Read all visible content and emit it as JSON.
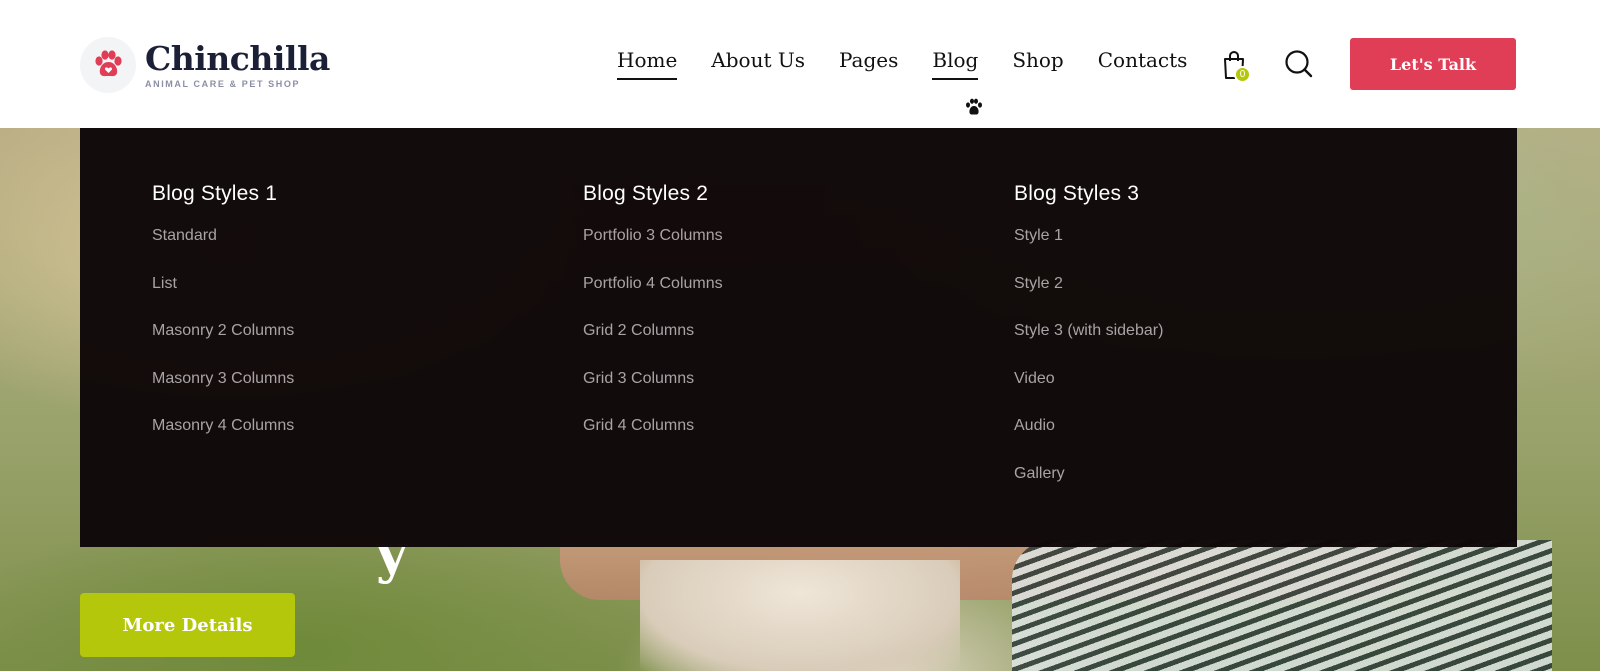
{
  "brand": {
    "name": "Chinchilla",
    "tagline": "ANIMAL CARE & PET SHOP",
    "accent": "#e03e56",
    "secondary": "#b5c70a"
  },
  "nav": {
    "items": [
      {
        "label": "Home",
        "active": true
      },
      {
        "label": "About Us",
        "active": false
      },
      {
        "label": "Pages",
        "active": false
      },
      {
        "label": "Blog",
        "active": true
      },
      {
        "label": "Shop",
        "active": false
      },
      {
        "label": "Contacts",
        "active": false
      }
    ]
  },
  "cart": {
    "count": "0"
  },
  "cta": {
    "label": "Let's Talk"
  },
  "mega_menu": {
    "columns": [
      {
        "title": "Blog Styles 1",
        "items": [
          "Standard",
          "List",
          "Masonry 2 Columns",
          "Masonry 3 Columns",
          "Masonry 4 Columns"
        ]
      },
      {
        "title": "Blog Styles 2",
        "items": [
          "Portfolio 3 Columns",
          "Portfolio 4 Columns",
          "Grid 2 Columns",
          "Grid 3 Columns",
          "Grid 4 Columns"
        ]
      },
      {
        "title": "Blog Styles 3",
        "items": [
          "Style 1",
          "Style 2",
          "Style 3 (with sidebar)",
          "Video",
          "Audio",
          "Gallery"
        ]
      }
    ]
  },
  "hero": {
    "title_fragment": "y",
    "button_label": "More Details"
  }
}
